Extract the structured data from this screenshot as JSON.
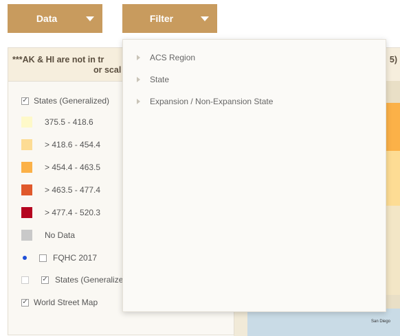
{
  "toolbar": {
    "data_label": "Data",
    "filter_label": "Filter"
  },
  "panel": {
    "note_line1": "***AK & HI are not in tr",
    "note_line2": "or scal",
    "map_header_tail": "5)"
  },
  "legend": {
    "states_layer_label": "States (Generalized)",
    "classes": [
      {
        "label": "375.5 - 418.6",
        "color": "#fef9c9"
      },
      {
        "label": "> 418.6 - 454.4",
        "color": "#fddc94"
      },
      {
        "label": "> 454.4 - 463.5",
        "color": "#fbb148"
      },
      {
        "label": "> 463.5 - 477.4",
        "color": "#e0592c"
      },
      {
        "label": "> 477.4 - 520.3",
        "color": "#b5041f"
      },
      {
        "label": "No Data",
        "color": "#c9c9c9"
      }
    ],
    "fqhc_label": "FQHC 2017",
    "states_generalized_label": "States (Generalize",
    "world_street_map_label": "World Street Map"
  },
  "map": {
    "city_label": "San Diego"
  },
  "filter_menu": {
    "items": [
      "ACS Region",
      "State",
      "Expansion / Non-Expansion State"
    ]
  },
  "colors": {
    "button_bg": "#c89b5e",
    "fqhc_dot": "#1f4fd8"
  }
}
